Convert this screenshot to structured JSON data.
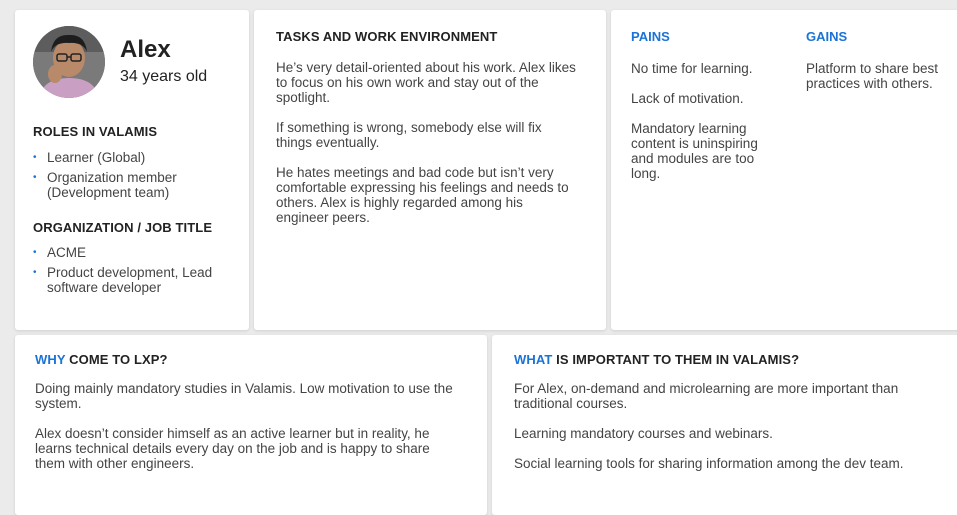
{
  "profile": {
    "name": "Alex",
    "age": "34 years old",
    "roles_heading": "ROLES IN VALAMIS",
    "roles": [
      "Learner (Global)",
      "Organization member (Development team)"
    ],
    "org_heading": "ORGANIZATION / JOB TITLE",
    "org": [
      "ACME",
      "Product development, Lead software developer"
    ]
  },
  "tasks": {
    "heading": "TASKS AND WORK ENVIRONMENT",
    "paragraphs": [
      "He’s very detail-oriented about his work. Alex likes to focus on his own work and stay out of the spotlight.",
      "If something is wrong, somebody else will fix things eventually.",
      "He hates meetings and bad code but isn’t very comfortable expressing his feelings and needs to others. Alex is highly regarded among his engineer peers."
    ]
  },
  "pains": {
    "heading": "PAINS",
    "items": [
      "No time for learning.",
      "Lack of motivation.",
      "Mandatory learning content is uninspiring and modules are too long."
    ]
  },
  "gains": {
    "heading": "GAINS",
    "items": [
      "Platform to share best practices with others."
    ]
  },
  "why": {
    "heading_accent": "WHY",
    "heading_rest": " COME TO LXP?",
    "paragraphs": [
      "Doing mainly mandatory studies in Valamis. Low motivation to use the system.",
      "Alex doesn’t consider himself as an active learner but in reality, he learns technical details every day on the job and is happy to share them with other engineers."
    ]
  },
  "what": {
    "heading_accent": "WHAT",
    "heading_rest": " IS IMPORTANT TO THEM IN VALAMIS?",
    "paragraphs": [
      "For Alex, on-demand and microlearning are more important than traditional courses.",
      "Learning mandatory courses and webinars.",
      "Social learning tools for sharing information among the dev team."
    ]
  },
  "colors": {
    "accent": "#1a73d6",
    "background": "#ebebeb",
    "card": "#ffffff"
  }
}
